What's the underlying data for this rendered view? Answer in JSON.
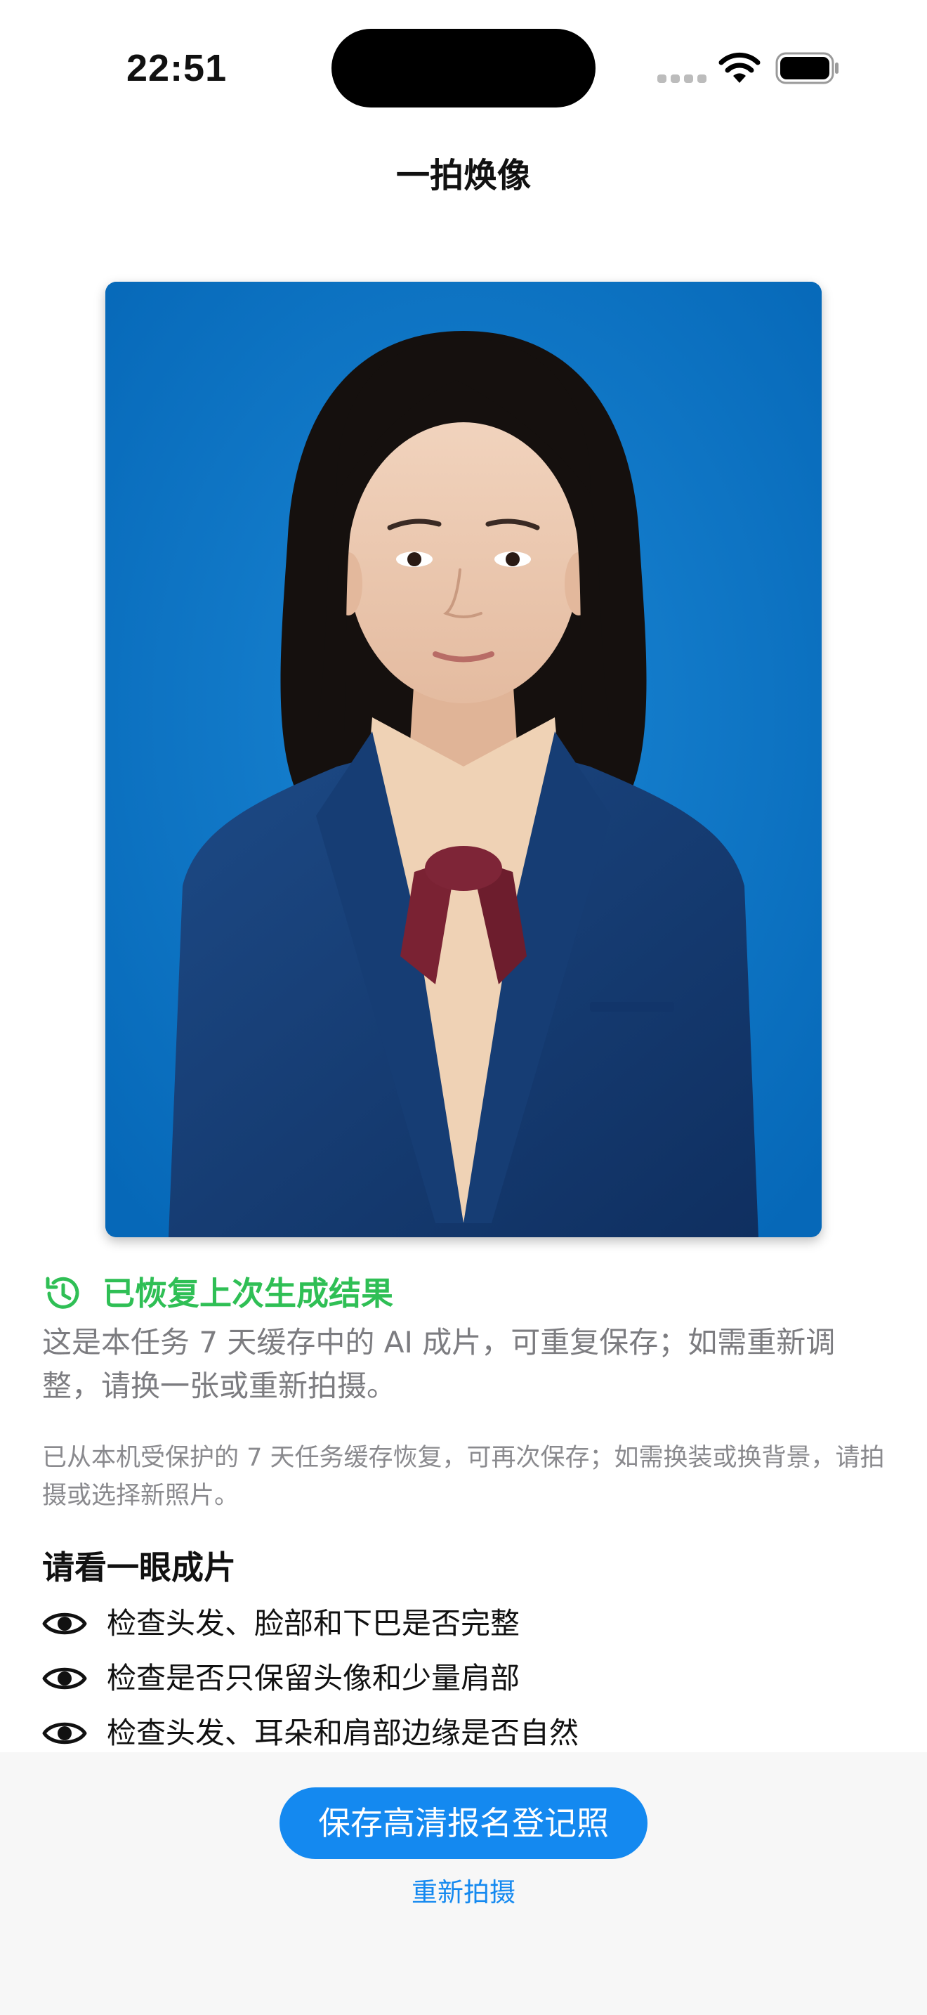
{
  "status_bar": {
    "time": "22:51",
    "wifi_icon": "wifi-icon",
    "battery_icon": "battery-icon",
    "signal_icon": "cellular-signal-icon"
  },
  "header": {
    "title": "一拍焕像"
  },
  "photo": {
    "description_icon": "id-photo-image",
    "background_color": "#0a76c8"
  },
  "restored": {
    "icon": "history-icon",
    "title": "已恢复上次生成结果",
    "title_color": "#2fbf55",
    "description": "这是本任务 7 天缓存中的 AI 成片，可重复保存；如需重新调整，请换一张或重新拍摄。",
    "cache_note": "已从本机受保护的 7 天任务缓存恢复，可再次保存；如需换装或换背景，请拍摄或选择新照片。"
  },
  "checklist": {
    "heading": "请看一眼成片",
    "item_icon": "eye-icon",
    "items": [
      {
        "label": "检查头发、脸部和下巴是否完整"
      },
      {
        "label": "检查是否只保留头像和少量肩部"
      },
      {
        "label": "检查头发、耳朵和肩部边缘是否自然"
      }
    ]
  },
  "actions": {
    "save_label": "保存高清报名登记照",
    "retake_label": "重新拍摄",
    "accent_color": "#1489f0"
  }
}
